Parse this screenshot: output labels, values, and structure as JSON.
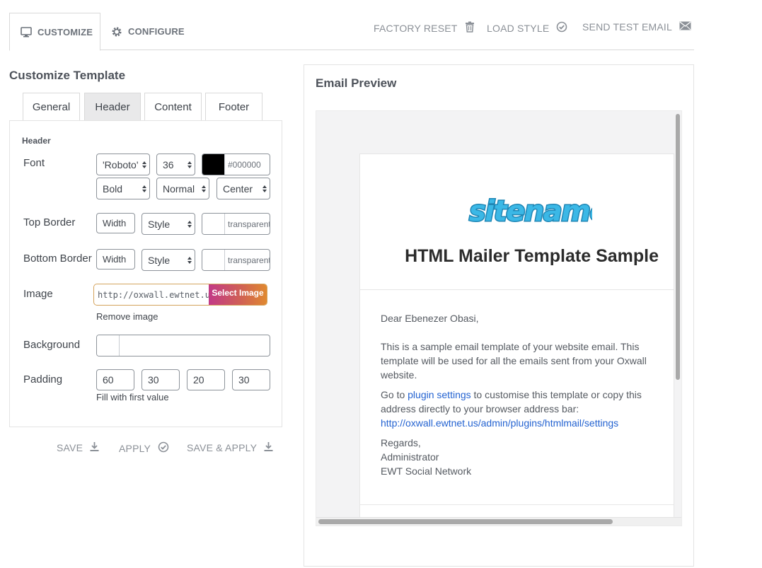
{
  "top_tabs": [
    {
      "label": "CUSTOMIZE",
      "icon": "monitor-icon",
      "active": true
    },
    {
      "label": "CONFIGURE",
      "icon": "gear-icon",
      "active": false
    }
  ],
  "top_actions": {
    "factory_reset": "FACTORY RESET",
    "load_style": "LOAD STYLE",
    "send_test_email": "SEND TEST EMAIL"
  },
  "customize": {
    "title": "Customize Template",
    "tabs": [
      "General",
      "Header",
      "Content",
      "Footer"
    ],
    "active_tab": "Header",
    "panel_heading": "Header",
    "font": {
      "label": "Font",
      "family": "'Roboto'",
      "size": "36",
      "color_hex": "#000000",
      "color_text": "#000000",
      "weight": "Bold",
      "style": "Normal",
      "align": "Center"
    },
    "top_border": {
      "label": "Top Border",
      "width_placeholder": "Width",
      "style": "Style",
      "color_text": "transparent"
    },
    "bottom_border": {
      "label": "Bottom Border",
      "width_placeholder": "Width",
      "style": "Style",
      "color_text": "transparent"
    },
    "image": {
      "label": "Image",
      "url": "http://oxwall.ewtnet.us/",
      "select_label": "Select Image",
      "remove_label": "Remove image"
    },
    "background": {
      "label": "Background"
    },
    "padding": {
      "label": "Padding",
      "values": [
        "60",
        "30",
        "20",
        "30"
      ],
      "note": "Fill with first value"
    },
    "actions": {
      "save": "SAVE",
      "apply": "APPLY",
      "save_apply": "SAVE & APPLY"
    }
  },
  "preview": {
    "title": "Email Preview",
    "logo_text": "sitename",
    "email_title": "HTML Mailer Template Sample",
    "greeting": "Dear Ebenezer Obasi,",
    "paragraph1": "This is a sample email template of your website email. This template will be used for all the emails sent from your Oxwall website.",
    "p2_before": "Go to ",
    "p2_link": "plugin settings",
    "p2_after": " to customise this template or copy this address directly to your browser address bar:",
    "settings_url": "http://oxwall.ewtnet.us/admin/plugins/htmlmail/settings",
    "regards": "Regards,",
    "signer": "Administrator",
    "network": "EWT Social Network"
  },
  "colors": {
    "accent_gradient_start": "#c23a87",
    "accent_gradient_end": "#e0892f",
    "logo_blue": "#3bb8e6",
    "link_blue": "#2463d1"
  }
}
